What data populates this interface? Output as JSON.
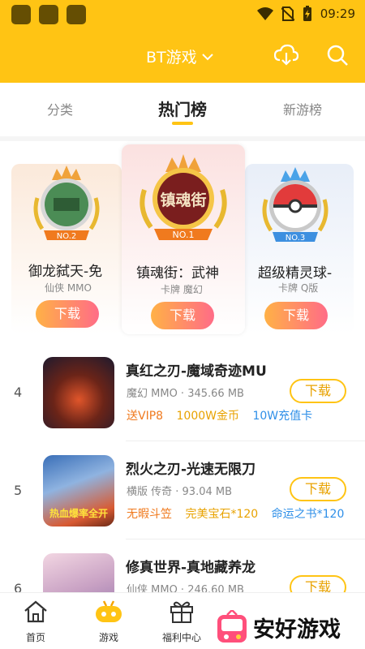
{
  "status_bar": {
    "time": "09:29"
  },
  "header": {
    "title": "BT游戏"
  },
  "tabs": [
    {
      "label": "分类"
    },
    {
      "label": "热门榜"
    },
    {
      "label": "新游榜"
    }
  ],
  "podium": [
    {
      "rank_badge": "NO.2",
      "name": "御龙弑天-免",
      "tags": "仙侠 MMO",
      "button": "下载"
    },
    {
      "rank_badge": "NO.1",
      "name": "镇魂街：武神",
      "tags": "卡牌 魔幻",
      "button": "下载",
      "thumb_text": "镇魂街"
    },
    {
      "rank_badge": "NO.3",
      "name": "超级精灵球-",
      "tags": "卡牌 Q版",
      "button": "下载"
    }
  ],
  "list": [
    {
      "rank": "4",
      "name": "真红之刃-魔域奇迹MU",
      "meta": "魔幻 MMO · 345.66 MB",
      "perks": [
        {
          "text": "送VIP8",
          "color": "#F07A1E"
        },
        {
          "text": "1000W金币",
          "color": "#E8A200"
        },
        {
          "text": "10W充值卡",
          "color": "#2E8FE8"
        }
      ],
      "button": "下载"
    },
    {
      "rank": "5",
      "name": "烈火之刃-光速无限刀",
      "meta": "横版 传奇 · 93.04 MB",
      "perks": [
        {
          "text": "无暇斗笠",
          "color": "#F07A1E"
        },
        {
          "text": "完美宝石*120",
          "color": "#E8A200"
        },
        {
          "text": "命运之书*120",
          "color": "#2E8FE8"
        }
      ],
      "button": "下载",
      "thumb_text": "热血爆率全开"
    },
    {
      "rank": "6",
      "name": "修真世界-真地藏养龙",
      "meta": "仙侠 MMO · 246.60 MB",
      "button": "下载"
    }
  ],
  "bottom_nav": [
    {
      "label": "首页",
      "icon": "home-icon"
    },
    {
      "label": "游戏",
      "icon": "gamepad-icon"
    },
    {
      "label": "福利中心",
      "icon": "gift-icon"
    }
  ],
  "watermark": {
    "text": "安好游戏"
  },
  "colors": {
    "primary": "#FFC414",
    "button_gradient_start": "#FFB146",
    "button_gradient_end": "#FF6C87"
  }
}
